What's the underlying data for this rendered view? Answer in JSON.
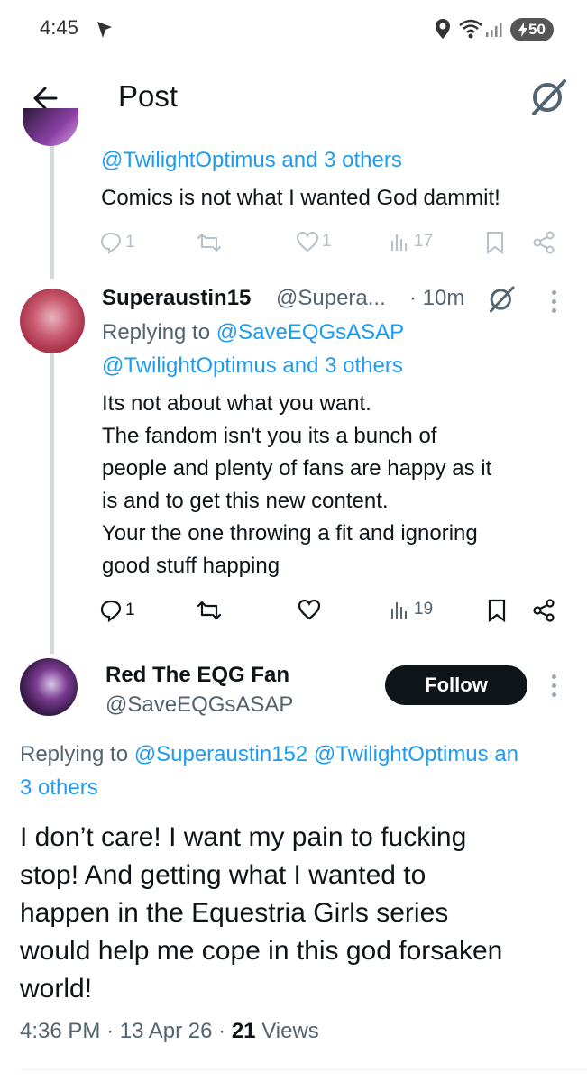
{
  "status_bar": {
    "time": "4:45",
    "battery": "50"
  },
  "header": {
    "title": "Post"
  },
  "tweet1": {
    "replying_to": "@TwilightOptimus and 3 others",
    "text": "Comics is not what I wanted God dammit!",
    "reply_count": "1",
    "like_count": "1",
    "views": "17"
  },
  "tweet2": {
    "name": "Superaustin15",
    "handle": "@Supera...",
    "time": "· 10m",
    "replying_label": "Replying to",
    "replying_handle": "@SaveEQGsASAP",
    "replying_others": "@TwilightOptimus and 3 others",
    "lines": [
      "Its not about what you want.",
      "The fandom isn't you its a bunch of",
      "people and plenty of fans are happy as it",
      "is and to get this new content.",
      "Your the one throwing a fit and ignoring",
      "good stuff happing"
    ],
    "reply_count": "1",
    "views": "19"
  },
  "main_tweet": {
    "name": "Red The EQG Fan",
    "handle": "@SaveEQGsASAP",
    "follow_label": "Follow",
    "replying_label": "Replying to",
    "replying_handles": "@Superaustin152 @TwilightOptimus an",
    "replying_others": "3 others",
    "lines": [
      "I don’t care! I want my pain to fucking",
      "stop! And getting what I wanted to",
      "happen in the Equestria Girls series",
      "would help me cope in this god forsaken",
      "world!"
    ],
    "time": "4:36 PM",
    "date": "13 Apr 26",
    "views_count": "21",
    "views_label": "Views"
  },
  "colors": {
    "link": "#1d9bf0",
    "secondary": "#536471",
    "text": "#0f1419",
    "thread": "#cfd9de"
  },
  "icons": [
    "back-arrow-icon",
    "grok-icon",
    "reply-icon",
    "repost-icon",
    "like-icon",
    "views-icon",
    "bookmark-icon",
    "share-icon",
    "more-icon"
  ]
}
